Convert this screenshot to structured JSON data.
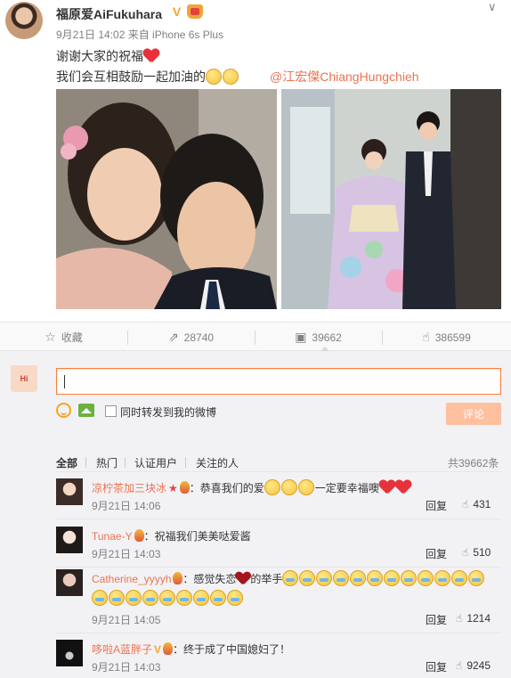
{
  "post": {
    "author": "福原爱AiFukuhara",
    "verified_mark": "V",
    "meta": "9月21日 14:02 来自 iPhone 6s Plus",
    "line1": "谢谢大家的祝福",
    "line2": "我们会互相鼓励一起加油的",
    "mention": "@江宏傑ChiangHungchieh",
    "images": [
      "selfie-photo",
      "kimono-photo"
    ],
    "accent_color": "#eb7350"
  },
  "actions": {
    "favorite": {
      "icon": "star-icon",
      "label": "收藏"
    },
    "repost": {
      "icon": "share-icon",
      "count": "28740"
    },
    "comment": {
      "icon": "comment-icon",
      "count": "39662"
    },
    "like": {
      "icon": "thumb-up-icon",
      "count": "386599"
    }
  },
  "composer": {
    "input_value": "",
    "also_repost_label": "同时转发到我的微博",
    "submit_label": "评论"
  },
  "comment_tabs": {
    "items": [
      "全部",
      "热门",
      "认证用户",
      "关注的人"
    ],
    "active": "全部",
    "total": "共39662条"
  },
  "comments": [
    {
      "name": "凉柠茶加三块冰",
      "text_prefix": "：恭喜我们的爱",
      "text_suffix": "一定要幸福噢",
      "time": "9月21日 14:06",
      "reply_label": "回复",
      "likes": "431"
    },
    {
      "name": "Tunae-Y",
      "text_prefix": "：祝福我们美美哒爱酱",
      "time": "9月21日 14:03",
      "reply_label": "回复",
      "likes": "510"
    },
    {
      "name": "Catherine_yyyyh",
      "text_prefix": "：感觉失恋",
      "text_suffix": "的举手",
      "time": "9月21日 14:05",
      "reply_label": "回复",
      "likes": "1214"
    },
    {
      "name": "哆啦A蓝胖子",
      "text_prefix": "：终于成了中国媳妇了！",
      "time": "9月21日 14:03",
      "reply_label": "回复",
      "likes": "9245"
    }
  ]
}
